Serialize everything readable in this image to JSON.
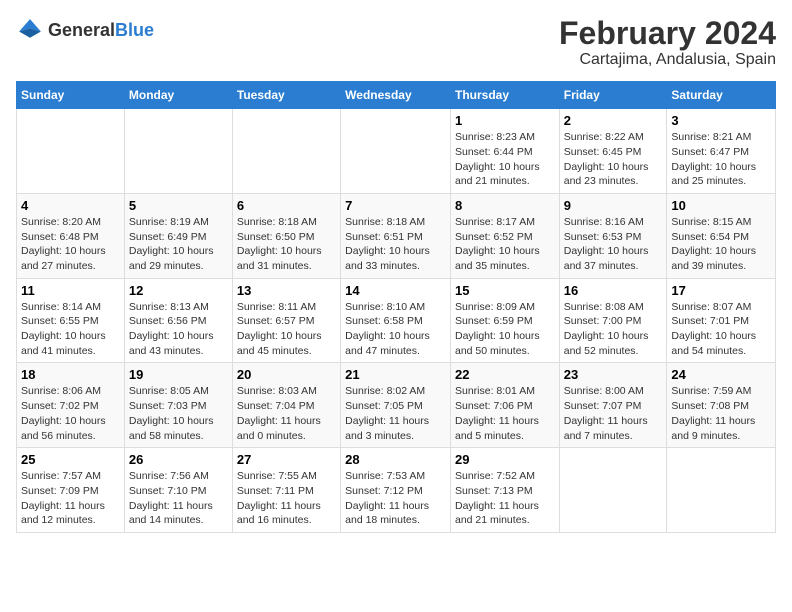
{
  "logo": {
    "text_general": "General",
    "text_blue": "Blue"
  },
  "title": "February 2024",
  "subtitle": "Cartajima, Andalusia, Spain",
  "days_of_week": [
    "Sunday",
    "Monday",
    "Tuesday",
    "Wednesday",
    "Thursday",
    "Friday",
    "Saturday"
  ],
  "weeks": [
    {
      "days": [
        {
          "num": "",
          "info": ""
        },
        {
          "num": "",
          "info": ""
        },
        {
          "num": "",
          "info": ""
        },
        {
          "num": "",
          "info": ""
        },
        {
          "num": "1",
          "info": "Sunrise: 8:23 AM\nSunset: 6:44 PM\nDaylight: 10 hours and 21 minutes."
        },
        {
          "num": "2",
          "info": "Sunrise: 8:22 AM\nSunset: 6:45 PM\nDaylight: 10 hours and 23 minutes."
        },
        {
          "num": "3",
          "info": "Sunrise: 8:21 AM\nSunset: 6:47 PM\nDaylight: 10 hours and 25 minutes."
        }
      ]
    },
    {
      "days": [
        {
          "num": "4",
          "info": "Sunrise: 8:20 AM\nSunset: 6:48 PM\nDaylight: 10 hours and 27 minutes."
        },
        {
          "num": "5",
          "info": "Sunrise: 8:19 AM\nSunset: 6:49 PM\nDaylight: 10 hours and 29 minutes."
        },
        {
          "num": "6",
          "info": "Sunrise: 8:18 AM\nSunset: 6:50 PM\nDaylight: 10 hours and 31 minutes."
        },
        {
          "num": "7",
          "info": "Sunrise: 8:18 AM\nSunset: 6:51 PM\nDaylight: 10 hours and 33 minutes."
        },
        {
          "num": "8",
          "info": "Sunrise: 8:17 AM\nSunset: 6:52 PM\nDaylight: 10 hours and 35 minutes."
        },
        {
          "num": "9",
          "info": "Sunrise: 8:16 AM\nSunset: 6:53 PM\nDaylight: 10 hours and 37 minutes."
        },
        {
          "num": "10",
          "info": "Sunrise: 8:15 AM\nSunset: 6:54 PM\nDaylight: 10 hours and 39 minutes."
        }
      ]
    },
    {
      "days": [
        {
          "num": "11",
          "info": "Sunrise: 8:14 AM\nSunset: 6:55 PM\nDaylight: 10 hours and 41 minutes."
        },
        {
          "num": "12",
          "info": "Sunrise: 8:13 AM\nSunset: 6:56 PM\nDaylight: 10 hours and 43 minutes."
        },
        {
          "num": "13",
          "info": "Sunrise: 8:11 AM\nSunset: 6:57 PM\nDaylight: 10 hours and 45 minutes."
        },
        {
          "num": "14",
          "info": "Sunrise: 8:10 AM\nSunset: 6:58 PM\nDaylight: 10 hours and 47 minutes."
        },
        {
          "num": "15",
          "info": "Sunrise: 8:09 AM\nSunset: 6:59 PM\nDaylight: 10 hours and 50 minutes."
        },
        {
          "num": "16",
          "info": "Sunrise: 8:08 AM\nSunset: 7:00 PM\nDaylight: 10 hours and 52 minutes."
        },
        {
          "num": "17",
          "info": "Sunrise: 8:07 AM\nSunset: 7:01 PM\nDaylight: 10 hours and 54 minutes."
        }
      ]
    },
    {
      "days": [
        {
          "num": "18",
          "info": "Sunrise: 8:06 AM\nSunset: 7:02 PM\nDaylight: 10 hours and 56 minutes."
        },
        {
          "num": "19",
          "info": "Sunrise: 8:05 AM\nSunset: 7:03 PM\nDaylight: 10 hours and 58 minutes."
        },
        {
          "num": "20",
          "info": "Sunrise: 8:03 AM\nSunset: 7:04 PM\nDaylight: 11 hours and 0 minutes."
        },
        {
          "num": "21",
          "info": "Sunrise: 8:02 AM\nSunset: 7:05 PM\nDaylight: 11 hours and 3 minutes."
        },
        {
          "num": "22",
          "info": "Sunrise: 8:01 AM\nSunset: 7:06 PM\nDaylight: 11 hours and 5 minutes."
        },
        {
          "num": "23",
          "info": "Sunrise: 8:00 AM\nSunset: 7:07 PM\nDaylight: 11 hours and 7 minutes."
        },
        {
          "num": "24",
          "info": "Sunrise: 7:59 AM\nSunset: 7:08 PM\nDaylight: 11 hours and 9 minutes."
        }
      ]
    },
    {
      "days": [
        {
          "num": "25",
          "info": "Sunrise: 7:57 AM\nSunset: 7:09 PM\nDaylight: 11 hours and 12 minutes."
        },
        {
          "num": "26",
          "info": "Sunrise: 7:56 AM\nSunset: 7:10 PM\nDaylight: 11 hours and 14 minutes."
        },
        {
          "num": "27",
          "info": "Sunrise: 7:55 AM\nSunset: 7:11 PM\nDaylight: 11 hours and 16 minutes."
        },
        {
          "num": "28",
          "info": "Sunrise: 7:53 AM\nSunset: 7:12 PM\nDaylight: 11 hours and 18 minutes."
        },
        {
          "num": "29",
          "info": "Sunrise: 7:52 AM\nSunset: 7:13 PM\nDaylight: 11 hours and 21 minutes."
        },
        {
          "num": "",
          "info": ""
        },
        {
          "num": "",
          "info": ""
        }
      ]
    }
  ]
}
